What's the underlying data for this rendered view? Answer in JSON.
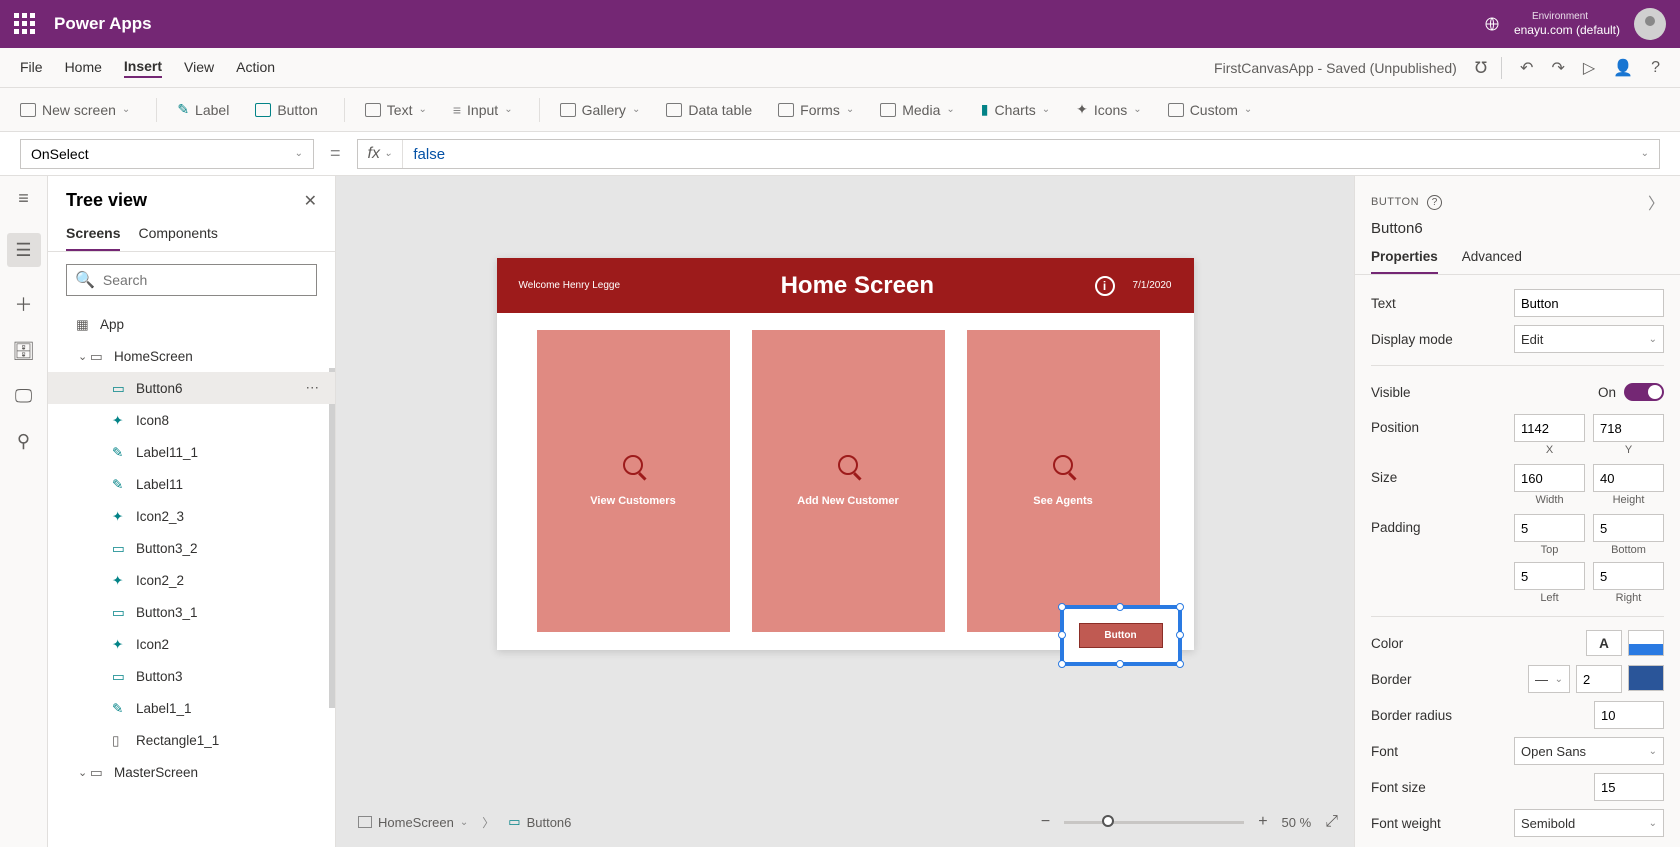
{
  "titlebar": {
    "appname": "Power Apps",
    "env_label": "Environment",
    "env_value": "enayu.com (default)"
  },
  "menubar": {
    "items": [
      "File",
      "Home",
      "Insert",
      "View",
      "Action"
    ],
    "active_index": 2,
    "docstatus": "FirstCanvasApp - Saved (Unpublished)"
  },
  "ribbon": {
    "items": [
      "New screen",
      "Label",
      "Button",
      "Text",
      "Input",
      "Gallery",
      "Data table",
      "Forms",
      "Media",
      "Charts",
      "Icons",
      "Custom"
    ]
  },
  "fx": {
    "property": "OnSelect",
    "value": "false"
  },
  "tree": {
    "title": "Tree view",
    "tabs": [
      "Screens",
      "Components"
    ],
    "active_tab": 0,
    "search_placeholder": "Search",
    "items": [
      {
        "label": "App",
        "level": 0,
        "kind": "app"
      },
      {
        "label": "HomeScreen",
        "level": 1,
        "kind": "screen",
        "expanded": true
      },
      {
        "label": "Button6",
        "level": 2,
        "kind": "button",
        "selected": true,
        "more": true
      },
      {
        "label": "Icon8",
        "level": 2,
        "kind": "icon"
      },
      {
        "label": "Label11_1",
        "level": 2,
        "kind": "label"
      },
      {
        "label": "Label11",
        "level": 2,
        "kind": "label"
      },
      {
        "label": "Icon2_3",
        "level": 2,
        "kind": "icon"
      },
      {
        "label": "Button3_2",
        "level": 2,
        "kind": "button"
      },
      {
        "label": "Icon2_2",
        "level": 2,
        "kind": "icon"
      },
      {
        "label": "Button3_1",
        "level": 2,
        "kind": "button"
      },
      {
        "label": "Icon2",
        "level": 2,
        "kind": "icon"
      },
      {
        "label": "Button3",
        "level": 2,
        "kind": "button"
      },
      {
        "label": "Label1_1",
        "level": 2,
        "kind": "label"
      },
      {
        "label": "Rectangle1_1",
        "level": 2,
        "kind": "rect"
      },
      {
        "label": "MasterScreen",
        "level": 1,
        "kind": "screen"
      }
    ]
  },
  "canvas": {
    "header": {
      "welcome": "Welcome Henry Legge",
      "title": "Home Screen",
      "date": "7/1/2020"
    },
    "cards": [
      "View Customers",
      "Add New Customer",
      "See Agents"
    ],
    "new_button_text": "Button",
    "breadcrumb": [
      "HomeScreen",
      "Button6"
    ],
    "zoom": {
      "percent": "50",
      "suffix": "%"
    }
  },
  "props": {
    "category": "Button",
    "name": "Button6",
    "tabs": [
      "Properties",
      "Advanced"
    ],
    "active_tab": 0,
    "rows": {
      "text": {
        "label": "Text",
        "value": "Button"
      },
      "display": {
        "label": "Display mode",
        "value": "Edit"
      },
      "visible": {
        "label": "Visible",
        "value": "On"
      },
      "position": {
        "label": "Position",
        "x": "1142",
        "y": "718",
        "xl": "X",
        "yl": "Y"
      },
      "size": {
        "label": "Size",
        "w": "160",
        "h": "40",
        "wl": "Width",
        "hl": "Height"
      },
      "padding": {
        "label": "Padding",
        "top": "5",
        "bottom": "5",
        "left": "5",
        "right": "5",
        "tl": "Top",
        "bl": "Bottom",
        "ll": "Left",
        "rl": "Right"
      },
      "color": {
        "label": "Color"
      },
      "border": {
        "label": "Border",
        "width": "2"
      },
      "borderradius": {
        "label": "Border radius",
        "value": "10"
      },
      "font": {
        "label": "Font",
        "value": "Open Sans"
      },
      "fontsize": {
        "label": "Font size",
        "value": "15"
      },
      "fontweight": {
        "label": "Font weight",
        "value": "Semibold"
      }
    }
  }
}
